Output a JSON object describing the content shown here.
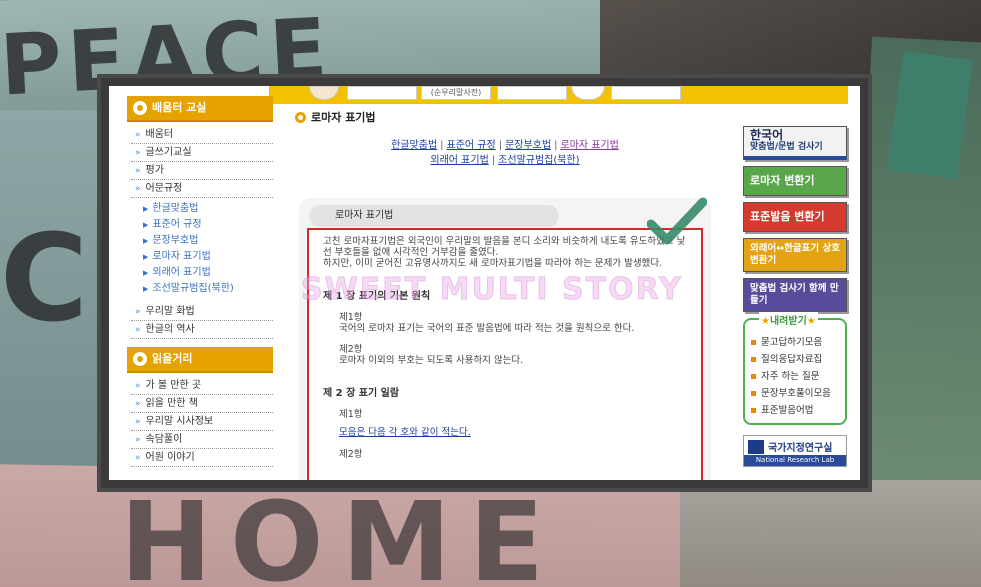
{
  "top_strip": {
    "label": "(순우리말사전)"
  },
  "sidebar": {
    "section1_title": "배움터 교실",
    "items_top": [
      "배움터",
      "글쓰기교실",
      "평가",
      "어문규정"
    ],
    "sub_items": [
      "한글맞춤법",
      "표준어 규정",
      "문장부호법",
      "로마자 표기법",
      "외래어 표기법",
      "조선말규범집(북한)"
    ],
    "items_bottom": [
      "우리말 화법",
      "한글의 역사"
    ],
    "section2_title": "읽을거리",
    "items_read": [
      "가 볼 만한 곳",
      "읽을 만한 책",
      "우리말 시사정보",
      "속담풀이",
      "어원 이야기"
    ]
  },
  "content": {
    "page_title": "로마자 표기법",
    "links_row1": [
      "한글맞춤법",
      "표준어 규정",
      "문장부호법",
      "로마자 표기법"
    ],
    "links_row2": [
      "외래어 표기법",
      "조선말규범집(북한)"
    ],
    "box_tab": "로마자 표기법",
    "intro_1": "고친 로마자표기법은 외국인이 우리말의 발음을 본디 소리와 비슷하게 내도록 유도하였고 낯선 부호들을 없애 시각적인 거부감을 줄였다.",
    "intro_2": "하지만, 이미 굳어진 고유명사까지도 새 로마자표기법을 따라야 하는 문제가 발생했다.",
    "chapter1": "제 1 장 표기의 기본 원칙",
    "ch1_clause1_label": "제1항",
    "ch1_clause1_text": "국어의 로마자 표기는 국어의 표준 발음법에 따라 적는 것을 원칙으로 한다.",
    "ch1_clause2_label": "제2항",
    "ch1_clause2_text": "로마자 이외의 부호는 되도록 사용하지 않는다.",
    "chapter2": "제 2 장 표기 일람",
    "ch2_clause1_label": "제1항",
    "ch2_clause1_link": "모음은 다음 각 호와 같이 적는다.",
    "ch2_clause2_label": "제2항"
  },
  "watermark": "SWEET MULTI STORY",
  "right": {
    "btn1_big": "한국어",
    "btn1_small": "맞춤법/문법 검사기",
    "btn2": "로마자 변환기",
    "btn3": "표준발음 변환기",
    "btn4": "외래어↔한글표기 상호변환기",
    "btn5": "맞춤법 검사기 함께 만들기",
    "download_title": "내려받기",
    "download_items": [
      "묻고답하기모음",
      "질의응답자료집",
      "자주 하는 질문",
      "문장부호풀이모음",
      "표준발음어법"
    ],
    "logo_name": "국가지정연구실",
    "logo_sub": "National Research Lab"
  },
  "background_signs": [
    "PEACE",
    "C",
    "HOME"
  ],
  "colors": {
    "accent_orange": "#e6a200",
    "box_border_red": "#d6272b",
    "link_blue": "#1a3fa0",
    "check_green": "#3a8a6a"
  }
}
